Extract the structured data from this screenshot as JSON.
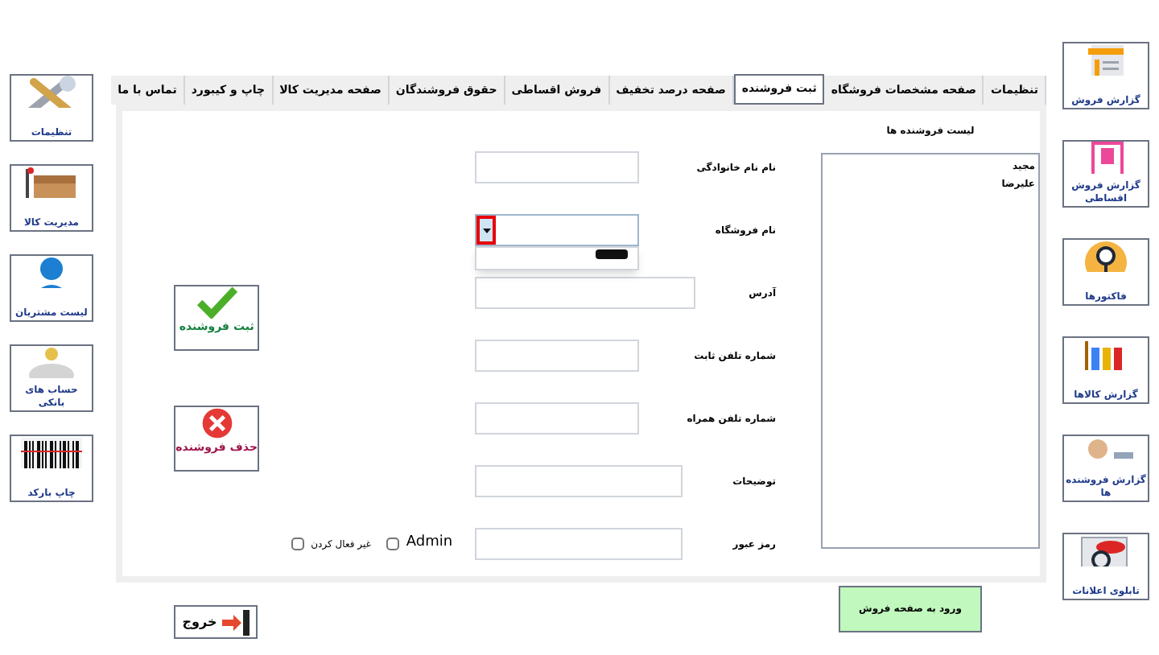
{
  "left_tiles": [
    {
      "caption": "تنظیمات"
    },
    {
      "caption": "مدیریت کالا"
    },
    {
      "caption": "لیست مشتریان"
    },
    {
      "caption": "حساب های بانکی"
    },
    {
      "caption": "چاپ بارکد"
    }
  ],
  "right_tiles": [
    {
      "caption": "گزارش فروش"
    },
    {
      "caption": "گزارش فروش اقساطی"
    },
    {
      "caption": "فاکتورها"
    },
    {
      "caption": "گزارش کالاها"
    },
    {
      "caption": "گزارش فروشنده ها"
    },
    {
      "caption": "تابلوی اعلانات"
    }
  ],
  "tabs": [
    {
      "label": "تنظیمات",
      "selected": false
    },
    {
      "label": "صفحه مشخصات فروشگاه",
      "selected": false
    },
    {
      "label": "ثبت فروشنده",
      "selected": true
    },
    {
      "label": "صفحه درصد تخفیف",
      "selected": false
    },
    {
      "label": "فروش اقساطی",
      "selected": false
    },
    {
      "label": "حقوق فروشندگان",
      "selected": false
    },
    {
      "label": "صفحه مدیریت کالا",
      "selected": false
    },
    {
      "label": "چاپ و کیبورد",
      "selected": false
    },
    {
      "label": "تماس با ما",
      "selected": false
    }
  ],
  "form": [
    {
      "kind": "text",
      "label": "نام نام خانوادگی"
    },
    {
      "kind": "combo",
      "label": "نام فروشگاه",
      "expanded": true
    },
    {
      "kind": "text",
      "label": "آدرس"
    },
    {
      "kind": "text",
      "label": "شماره تلفن ثابت"
    },
    {
      "kind": "text",
      "label": "شماره تلفن همراه"
    },
    {
      "kind": "text",
      "label": "توضیحات"
    },
    {
      "kind": "password",
      "label": "رمز عبور"
    }
  ],
  "checkboxes": [
    {
      "label": "Admin",
      "checked": false
    },
    {
      "label": "غیر فعال کردن",
      "checked": false
    }
  ],
  "sellers": {
    "title": "لیست فروشنده ها",
    "items": [
      "مجید",
      "علیرضا"
    ]
  },
  "buttons": {
    "save": "ثبت فروشنده",
    "delete": "حذف فروشنده",
    "exit": "خروج",
    "enter_sales": "ورود به صفحه فروش"
  }
}
